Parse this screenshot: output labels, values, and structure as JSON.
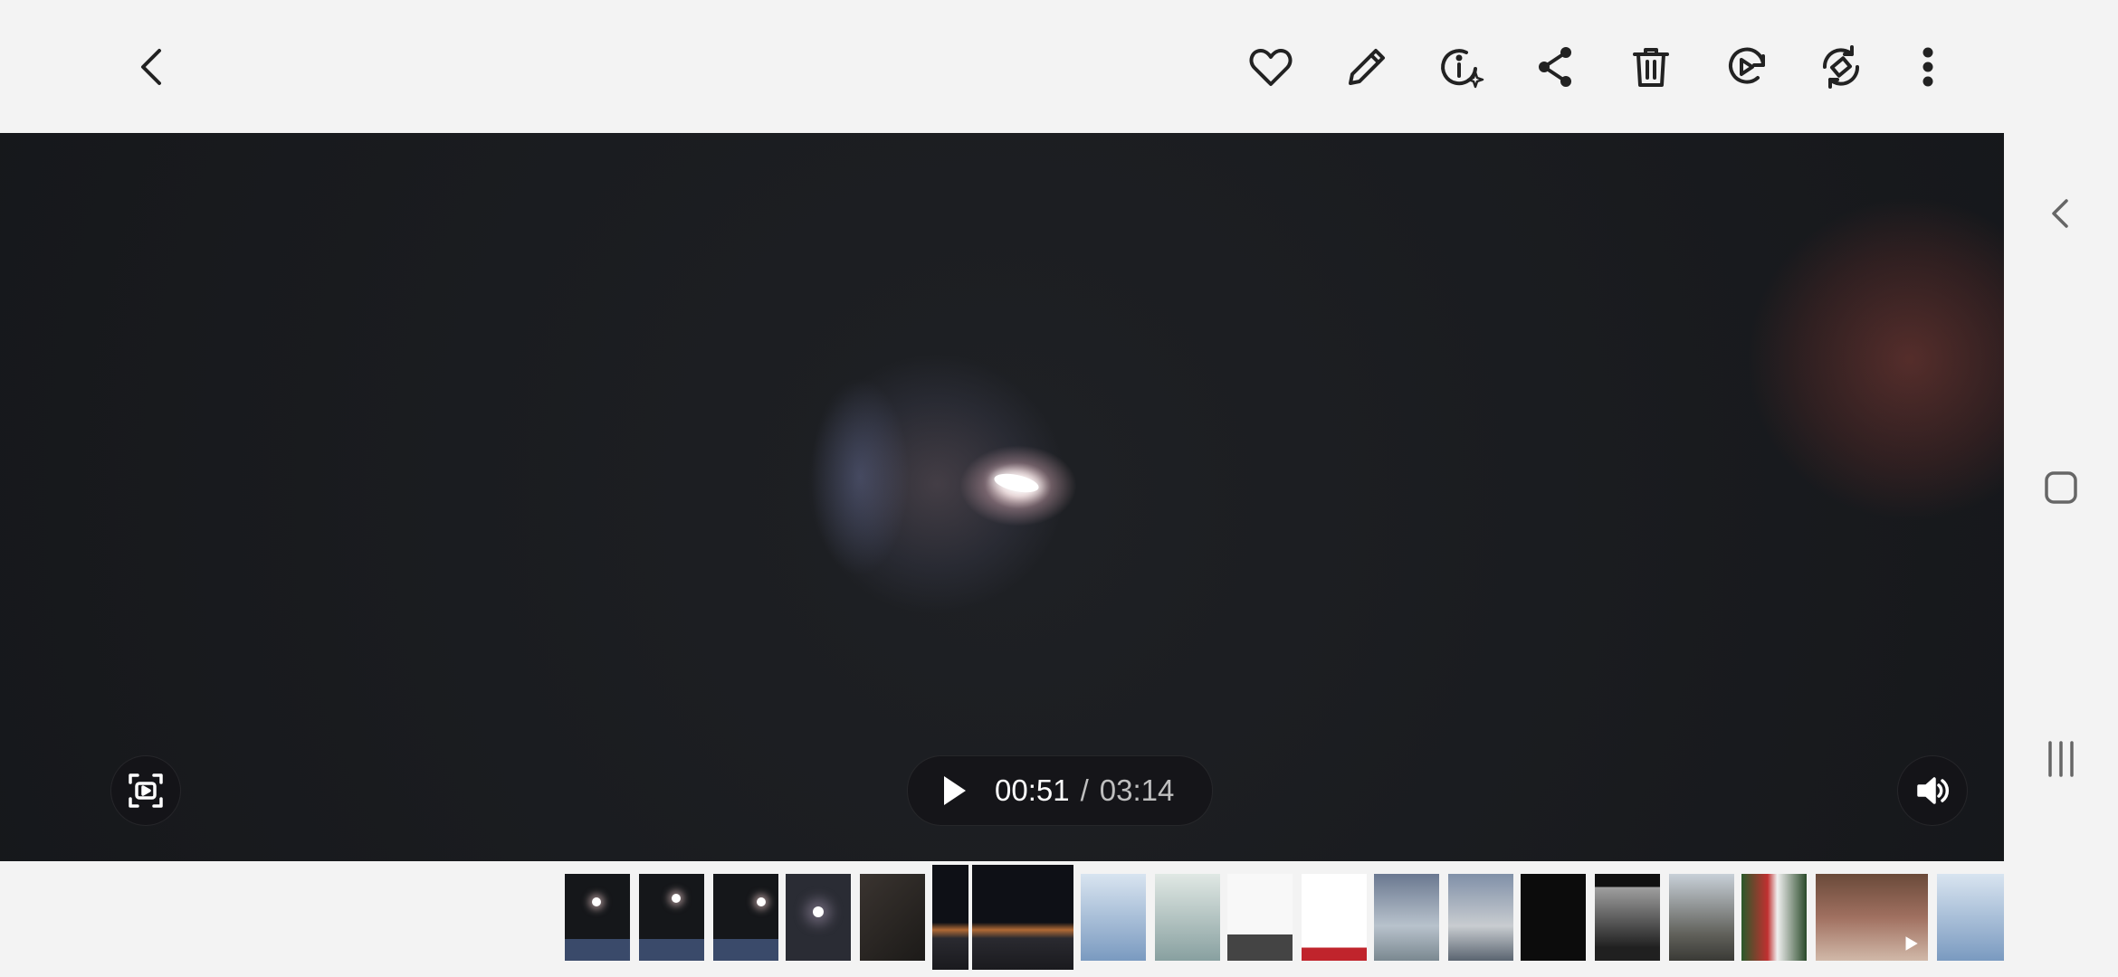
{
  "toolbar": {
    "back_icon": "chevron-left-icon",
    "actions": [
      "heart-icon",
      "pencil-icon",
      "info-ai-icon",
      "share-icon",
      "trash-icon",
      "remaster-video-icon",
      "rotate-icon",
      "more-vertical-icon"
    ]
  },
  "player": {
    "current_time": "00:51",
    "separator": "/",
    "total_time": "03:14",
    "play_icon": "play-icon",
    "capture_icon": "video-capture-icon",
    "volume_icon": "volume-icon"
  },
  "filmstrip": {
    "thumbnails": [
      "screenshot-dark",
      "screenshot-dark",
      "screenshot-dark",
      "night-light-photo",
      "handwritten-note",
      "video-night-sunset",
      "night-street",
      "spreadsheet",
      "spreadsheet",
      "document-photo",
      "text-document",
      "cloudy-sky",
      "cloudy-sky",
      "dark-post",
      "group-photo",
      "parking-lot",
      "christmas-snowman",
      "bedroom-video",
      "spreadsheet"
    ]
  },
  "system_nav": {
    "items": [
      "back-icon",
      "home-icon",
      "recents-icon"
    ]
  },
  "colors": {
    "bar_background": "#f3f3f3",
    "viewer_background": "#1a1c20",
    "icon_dark": "#222222"
  }
}
